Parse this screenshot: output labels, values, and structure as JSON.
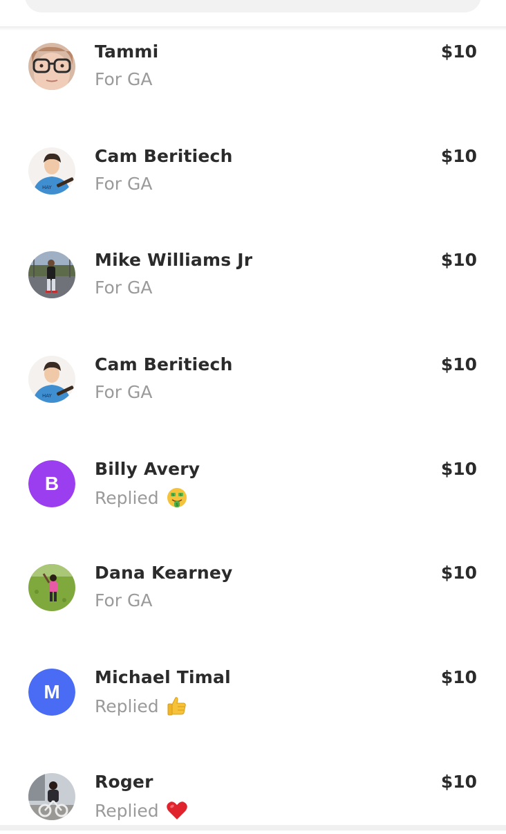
{
  "colors": {
    "name": "#2b2b2b",
    "subtitle": "#9a9a9a",
    "avatar_purple": "#9b3ef0",
    "avatar_blue": "#4a6cf5"
  },
  "payments": [
    {
      "name": "Tammi",
      "note": "For GA",
      "amount": "$10",
      "avatar": "photo"
    },
    {
      "name": "Cam Beritiech",
      "note": "For GA",
      "amount": "$10",
      "avatar": "photo"
    },
    {
      "name": "Mike Williams Jr",
      "note": "For GA",
      "amount": "$10",
      "avatar": "photo"
    },
    {
      "name": "Cam Beritiech",
      "note": "For GA",
      "amount": "$10",
      "avatar": "photo"
    },
    {
      "name": "Billy Avery",
      "note": "Replied",
      "emoji": "money-mouth-face",
      "amount": "$10",
      "avatar_letter": "B"
    },
    {
      "name": "Dana Kearney",
      "note": "For GA",
      "amount": "$10",
      "avatar": "photo"
    },
    {
      "name": "Michael Timal",
      "note": "Replied",
      "emoji": "thumbs-up",
      "amount": "$10",
      "avatar_letter": "M"
    },
    {
      "name": "Roger",
      "note": "Replied",
      "emoji": "red-heart",
      "amount": "$10",
      "avatar": "photo"
    }
  ]
}
